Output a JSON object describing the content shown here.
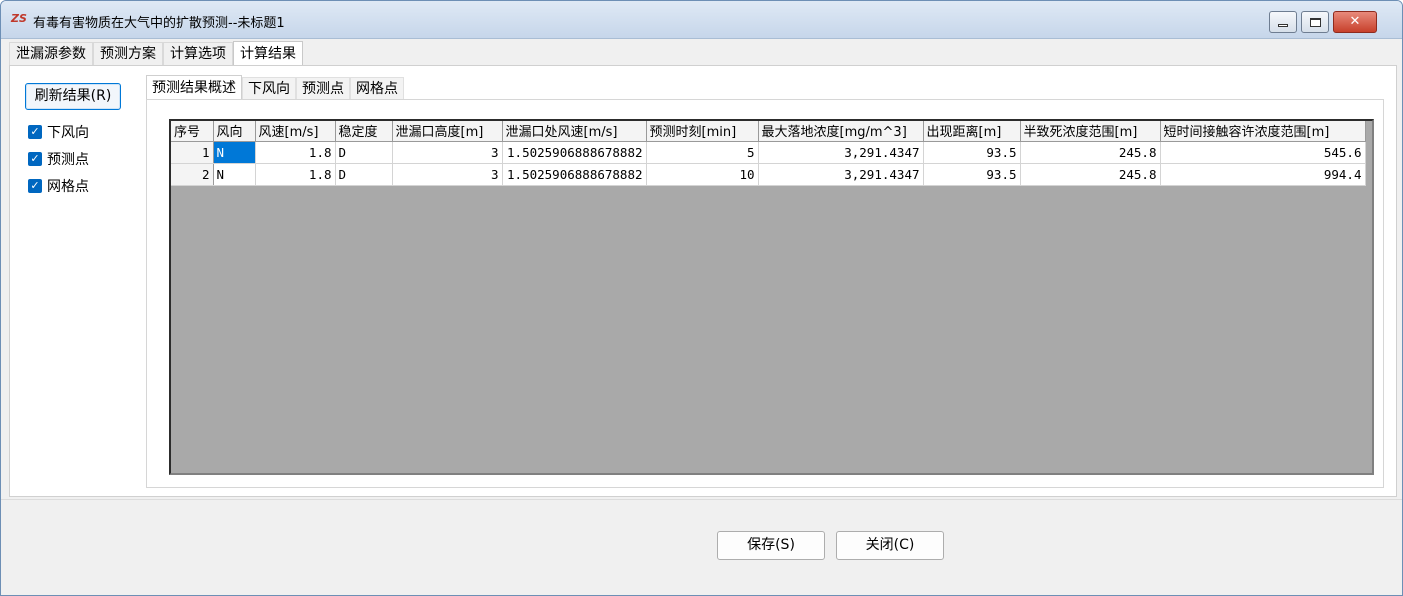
{
  "window": {
    "title": "有毒有害物质在大气中的扩散预测--未标题1",
    "app_icon": "ZS"
  },
  "top_tabs": [
    {
      "label": "泄漏源参数"
    },
    {
      "label": "预测方案"
    },
    {
      "label": "计算选项"
    },
    {
      "label": "计算结果"
    }
  ],
  "active_top_tab": "计算结果",
  "left_panel": {
    "refresh_label": "刷新结果(R)",
    "checks": [
      {
        "label": "下风向",
        "checked": true
      },
      {
        "label": "预测点",
        "checked": true
      },
      {
        "label": "网格点",
        "checked": true
      }
    ]
  },
  "sub_tabs": [
    {
      "label": "预测结果概述"
    },
    {
      "label": "下风向"
    },
    {
      "label": "预测点"
    },
    {
      "label": "网格点"
    }
  ],
  "active_sub_tab": "预测结果概述",
  "table": {
    "headers": [
      "序号",
      "风向",
      "风速[m/s]",
      "稳定度",
      "泄漏口高度[m]",
      "泄漏口处风速[m/s]",
      "预测时刻[min]",
      "最大落地浓度[mg/m^3]",
      "出现距离[m]",
      "半致死浓度范围[m]",
      "短时间接触容许浓度范围[m]"
    ],
    "rows": [
      [
        "1",
        "N",
        "1.8",
        "D",
        "3",
        "1.5025906888678882",
        "5",
        "3,291.4347",
        "93.5",
        "245.8",
        "545.6"
      ],
      [
        "2",
        "N",
        "1.8",
        "D",
        "3",
        "1.5025906888678882",
        "10",
        "3,291.4347",
        "93.5",
        "245.8",
        "994.4"
      ]
    ]
  },
  "footer": {
    "save_label": "保存(S)",
    "close_label": "关闭(C)"
  },
  "colors": {
    "accent": "#0078d7",
    "grid_background": "#a9a9a9"
  }
}
